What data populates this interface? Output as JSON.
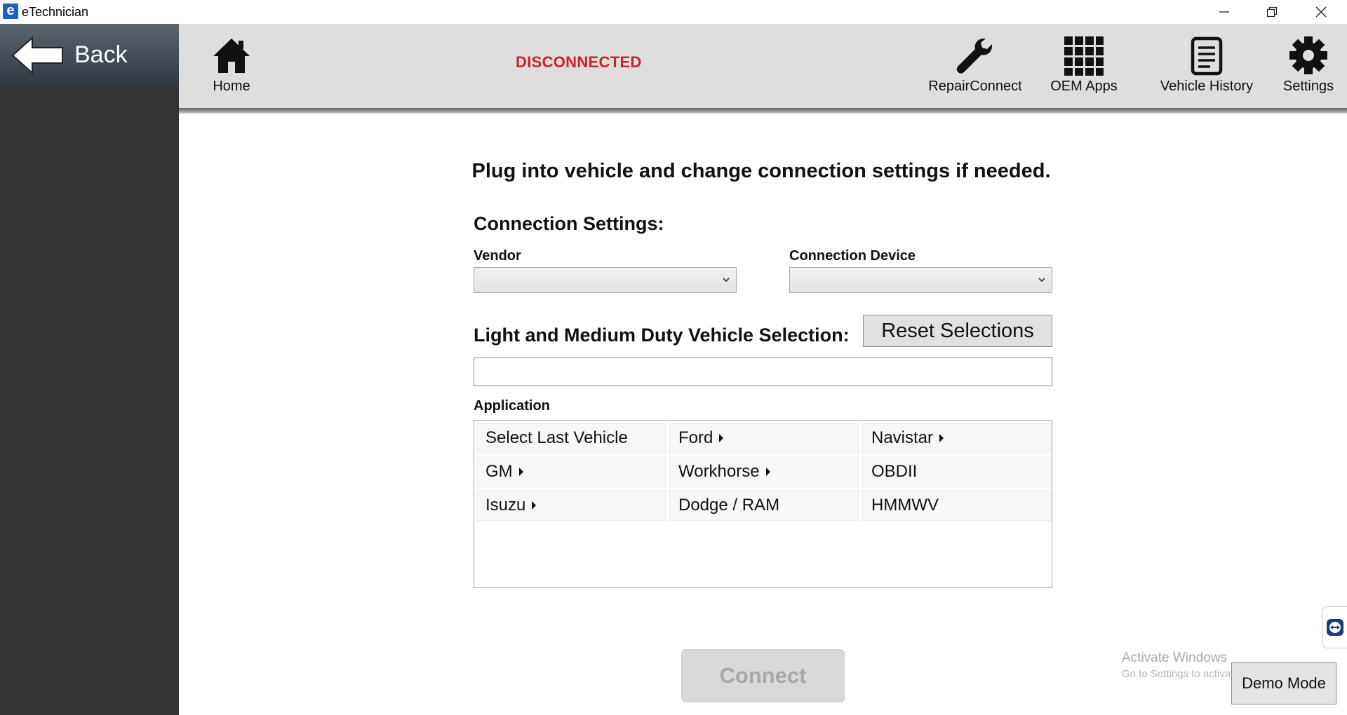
{
  "window": {
    "app_icon_letter": "e",
    "title": "eTechnician"
  },
  "sidebar": {
    "back_label": "Back"
  },
  "topnav": {
    "status": "DISCONNECTED",
    "home_label": "Home",
    "items": [
      {
        "label": "RepairConnect",
        "icon": "wrench-icon"
      },
      {
        "label": "OEM Apps",
        "icon": "grid-icon"
      },
      {
        "label": "Vehicle History",
        "icon": "document-icon"
      },
      {
        "label": "Settings",
        "icon": "gear-icon"
      }
    ]
  },
  "main": {
    "title": "Plug into vehicle and change connection settings if needed.",
    "connection_settings_title": "Connection Settings:",
    "vendor_label": "Vendor",
    "vendor_value": "",
    "device_label": "Connection Device",
    "device_value": "",
    "vehicle_selection_title": "Light and Medium Duty Vehicle Selection:",
    "reset_label": "Reset Selections",
    "vehicle_input_value": "",
    "application_label": "Application",
    "applications": [
      {
        "label": "Select Last Vehicle",
        "has_submenu": false
      },
      {
        "label": "Ford",
        "has_submenu": true
      },
      {
        "label": "Navistar",
        "has_submenu": true
      },
      {
        "label": "GM",
        "has_submenu": true
      },
      {
        "label": "Workhorse",
        "has_submenu": true
      },
      {
        "label": "OBDII",
        "has_submenu": false
      },
      {
        "label": "Isuzu",
        "has_submenu": true
      },
      {
        "label": "Dodge / RAM",
        "has_submenu": false
      },
      {
        "label": "HMMWV",
        "has_submenu": false
      }
    ],
    "connect_label": "Connect"
  },
  "overlay": {
    "activate_title": "Activate Windows",
    "activate_sub": "Go to Settings to activate Windows.",
    "demo_label": "Demo Mode"
  }
}
